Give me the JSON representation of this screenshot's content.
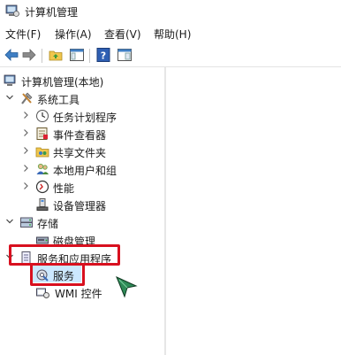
{
  "window": {
    "title": "计算机管理"
  },
  "menu": {
    "file": "文件(F)",
    "action": "操作(A)",
    "view": "查看(V)",
    "help": "帮助(H)"
  },
  "tree": {
    "root": "计算机管理(本地)",
    "system_tools": "系统工具",
    "task_scheduler": "任务计划程序",
    "event_viewer": "事件查看器",
    "shared_folders": "共享文件夹",
    "local_users": "本地用户和组",
    "performance": "性能",
    "device_manager": "设备管理器",
    "storage": "存储",
    "disk_management": "磁盘管理",
    "services_apps": "服务和应用程序",
    "services": "服务",
    "wmi": "WMI 控件"
  },
  "colors": {
    "highlight": "#d8101f",
    "selection": "#cce8ff",
    "cursor": "#2e8b57"
  }
}
